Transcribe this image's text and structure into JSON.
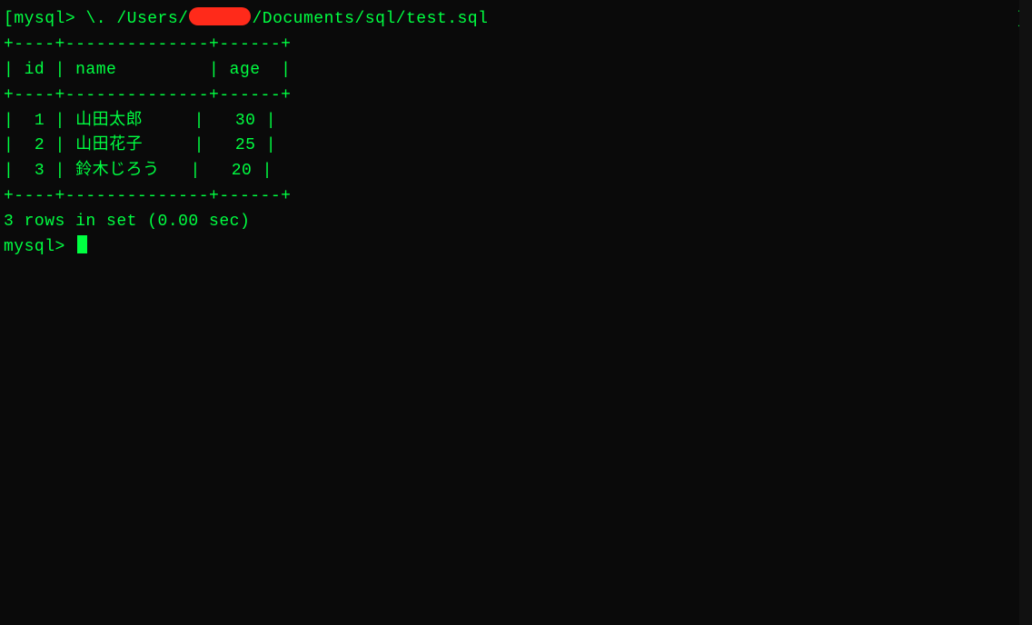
{
  "prompt_prefix": "mysql>",
  "bracket_open": "[",
  "bracket_close": "]",
  "command": {
    "source_cmd": "\\.",
    "path_prefix": " /Users/",
    "path_suffix": "/Documents/sql/test.sql"
  },
  "table": {
    "border_top": "+----+--------------+------+",
    "border_mid": "+----+--------------+------+",
    "border_bottom": "+----+--------------+------+",
    "header_line": "| id | name         | age  |",
    "columns": [
      "id",
      "name",
      "age"
    ],
    "rows": [
      {
        "id": 1,
        "name": "山田太郎",
        "age": 30,
        "line": "|  1 | 山田太郎     |   30 |"
      },
      {
        "id": 2,
        "name": "山田花子",
        "age": 25,
        "line": "|  2 | 山田花子     |   25 |"
      },
      {
        "id": 3,
        "name": "鈴木じろう",
        "age": 20,
        "line": "|  3 | 鈴木じろう   |   20 |"
      }
    ]
  },
  "status_line": "3 rows in set (0.00 sec)",
  "blank_line": "",
  "second_prompt": "mysql> "
}
